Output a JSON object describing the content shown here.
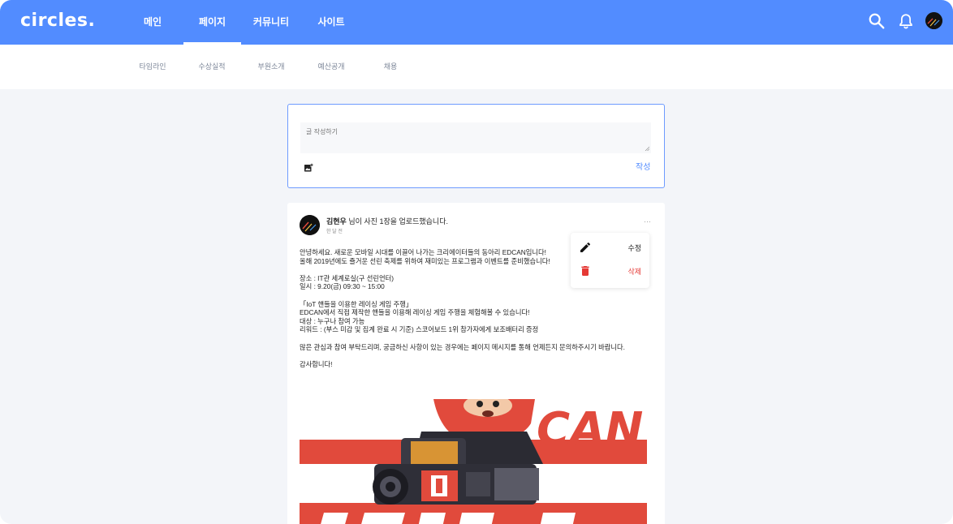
{
  "app": {
    "logo": "circles.",
    "nav": [
      {
        "label": "메인",
        "active": false
      },
      {
        "label": "페이지",
        "active": true
      },
      {
        "label": "커뮤니티",
        "active": false
      },
      {
        "label": "사이트",
        "active": false
      }
    ],
    "icons": [
      "search-icon",
      "bell-icon",
      "avatar"
    ],
    "accent": "#528cff"
  },
  "subnav": [
    "타임라인",
    "수상실적",
    "부원소개",
    "예산공개",
    "채용"
  ],
  "composer": {
    "placeholder": "글 작성하기",
    "submit_label": "작성",
    "image_icon": "add-photo-icon"
  },
  "post": {
    "author": "김현우",
    "action": " 님이 사진 1장을 업로드했습니다.",
    "time": "한 달 전",
    "more": "···",
    "body": [
      "안녕하세요. 새로운 모바일 시대를 이끌어 나가는 크리에이터들의 동아리 EDCAN입니다!",
      "올해 2019년에도 즐거운 선린 축제를 위하여 재미있는 프로그램과 이벤트를 준비했습니다!",
      "",
      "장소 : IT관 세계로실(구 선린언터)",
      "일시 : 9.20(금) 09:30 ~ 15:00",
      "",
      "「IoT 핸들을 이용한 레이싱 게임 주행」",
      "EDCAN에서 직접 제작한 핸들을 이용해 레이싱 게임 주행을 체험해볼 수 있습니다!",
      "대상 : 누구나 참여 가능",
      "리워드 : (부스 미감 및 집계 완료 시 기준) 스코어보드 1위 참가자에게 보조배터리 증정",
      "",
      "많은 관심과 참여 부탁드리며, 궁금하신 사항이 있는 경우에는 페이지 메시지를 통해 언제든지 문의하주시기 바랍니다.",
      "",
      "감사합니다!"
    ],
    "image_text": "CAN"
  },
  "menu": {
    "edit_label": "수정",
    "delete_label": "삭제",
    "delete_color": "#e53935"
  }
}
